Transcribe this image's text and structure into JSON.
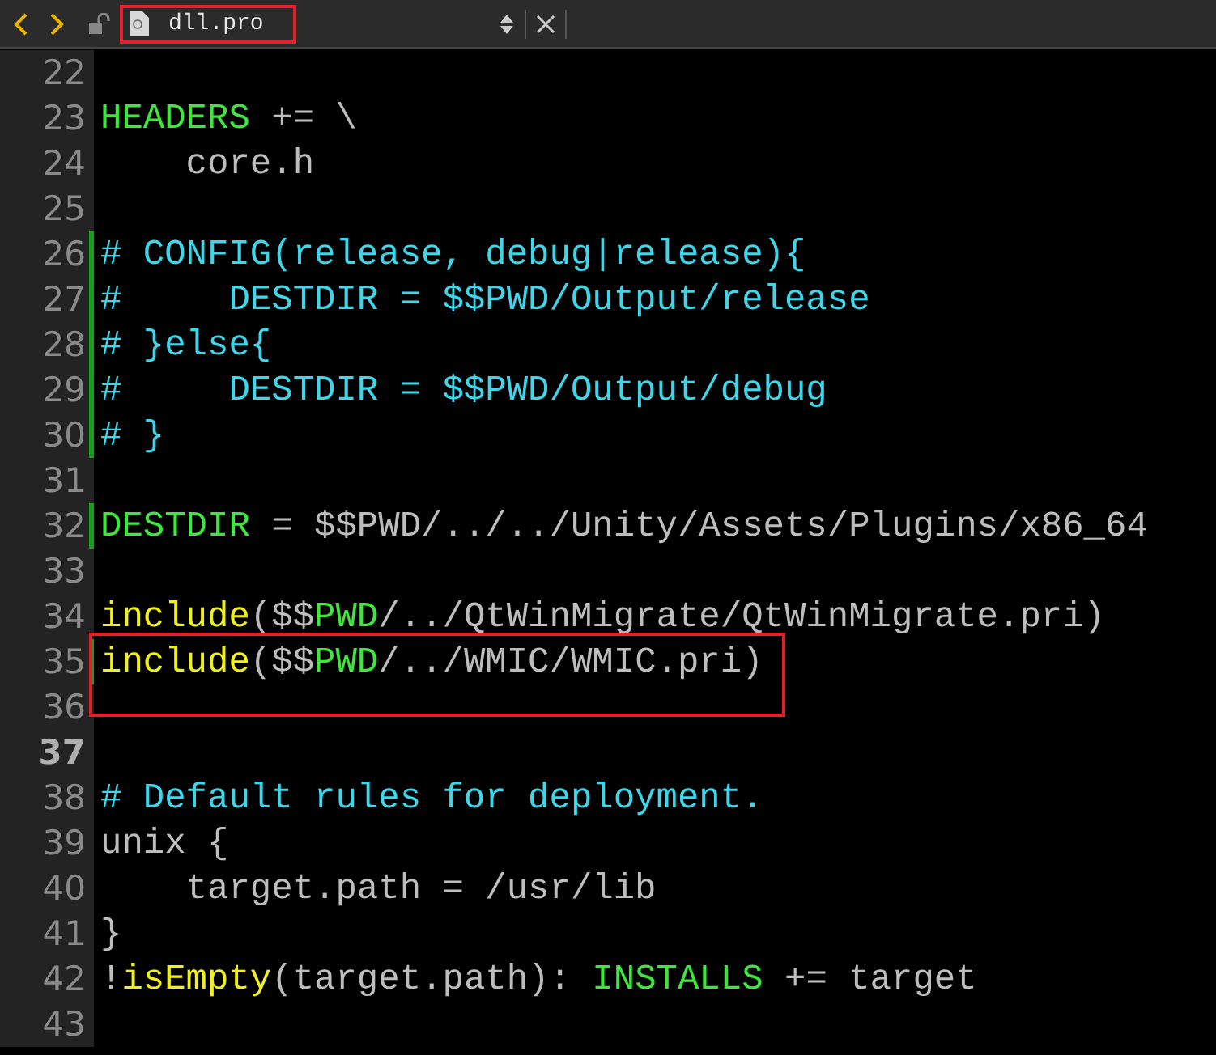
{
  "toolbar": {
    "file_tab": {
      "name": "dll.pro",
      "annotated": true
    }
  },
  "lines": [
    {
      "number": "22",
      "current": false,
      "modified": false,
      "annotated": false
    },
    {
      "number": "23",
      "current": false,
      "modified": false,
      "annotated": false,
      "tokens": [
        {
          "text": "HEADERS",
          "kind": "keyword"
        },
        {
          "text": " += \\",
          "kind": "plain"
        }
      ]
    },
    {
      "number": "24",
      "current": false,
      "modified": false,
      "annotated": false,
      "tokens": [
        {
          "text": "    core.h",
          "kind": "plain"
        }
      ]
    },
    {
      "number": "25",
      "current": false,
      "modified": false,
      "annotated": false
    },
    {
      "number": "26",
      "current": false,
      "modified": true,
      "annotated": false,
      "tokens": [
        {
          "text": "# CONFIG(release, debug|release){",
          "kind": "comment"
        }
      ]
    },
    {
      "number": "27",
      "current": false,
      "modified": true,
      "annotated": false,
      "tokens": [
        {
          "text": "#     DESTDIR = $$PWD/Output/release",
          "kind": "comment"
        }
      ]
    },
    {
      "number": "28",
      "current": false,
      "modified": true,
      "annotated": false,
      "tokens": [
        {
          "text": "# }else{",
          "kind": "comment"
        }
      ]
    },
    {
      "number": "29",
      "current": false,
      "modified": true,
      "annotated": false,
      "tokens": [
        {
          "text": "#     DESTDIR = $$PWD/Output/debug",
          "kind": "comment"
        }
      ]
    },
    {
      "number": "30",
      "current": false,
      "modified": true,
      "annotated": false,
      "tokens": [
        {
          "text": "# }",
          "kind": "comment"
        }
      ]
    },
    {
      "number": "31",
      "current": false,
      "modified": false,
      "annotated": false
    },
    {
      "number": "32",
      "current": false,
      "modified": true,
      "annotated": false,
      "tokens": [
        {
          "text": "DESTDIR",
          "kind": "keyword"
        },
        {
          "text": " = $$PWD/../../Unity/Assets/Plugins/x86_64",
          "kind": "plain"
        }
      ]
    },
    {
      "number": "33",
      "current": false,
      "modified": false,
      "annotated": false
    },
    {
      "number": "34",
      "current": false,
      "modified": false,
      "annotated": false,
      "tokens": [
        {
          "text": "include",
          "kind": "function"
        },
        {
          "text": "($$",
          "kind": "plain"
        },
        {
          "text": "PWD",
          "kind": "keyword"
        },
        {
          "text": "/../QtWinMigrate/QtWinMigrate.pri)",
          "kind": "plain"
        }
      ]
    },
    {
      "number": "35",
      "current": false,
      "modified": true,
      "annotated": true,
      "tokens": [
        {
          "text": "include",
          "kind": "function"
        },
        {
          "text": "($$",
          "kind": "plain"
        },
        {
          "text": "PWD",
          "kind": "keyword"
        },
        {
          "text": "/../WMIC/WMIC.pri)",
          "kind": "plain"
        }
      ]
    },
    {
      "number": "36",
      "current": false,
      "modified": false,
      "annotated": true
    },
    {
      "number": "37",
      "current": true,
      "modified": false,
      "annotated": false
    },
    {
      "number": "38",
      "current": false,
      "modified": false,
      "annotated": false,
      "tokens": [
        {
          "text": "# Default rules for deployment.",
          "kind": "comment"
        }
      ]
    },
    {
      "number": "39",
      "current": false,
      "modified": false,
      "annotated": false,
      "tokens": [
        {
          "text": "unix {",
          "kind": "plain"
        }
      ]
    },
    {
      "number": "40",
      "current": false,
      "modified": false,
      "annotated": false,
      "tokens": [
        {
          "text": "    target.path = /usr/lib",
          "kind": "plain"
        }
      ]
    },
    {
      "number": "41",
      "current": false,
      "modified": false,
      "annotated": false,
      "tokens": [
        {
          "text": "}",
          "kind": "plain"
        }
      ]
    },
    {
      "number": "42",
      "current": false,
      "modified": false,
      "annotated": false,
      "tokens": [
        {
          "text": "!",
          "kind": "plain"
        },
        {
          "text": "isEmpty",
          "kind": "function"
        },
        {
          "text": "(target.path): ",
          "kind": "plain"
        },
        {
          "text": "INSTALLS",
          "kind": "keyword"
        },
        {
          "text": " += target",
          "kind": "plain"
        }
      ]
    },
    {
      "number": "43",
      "current": false,
      "modified": false,
      "annotated": false
    }
  ]
}
